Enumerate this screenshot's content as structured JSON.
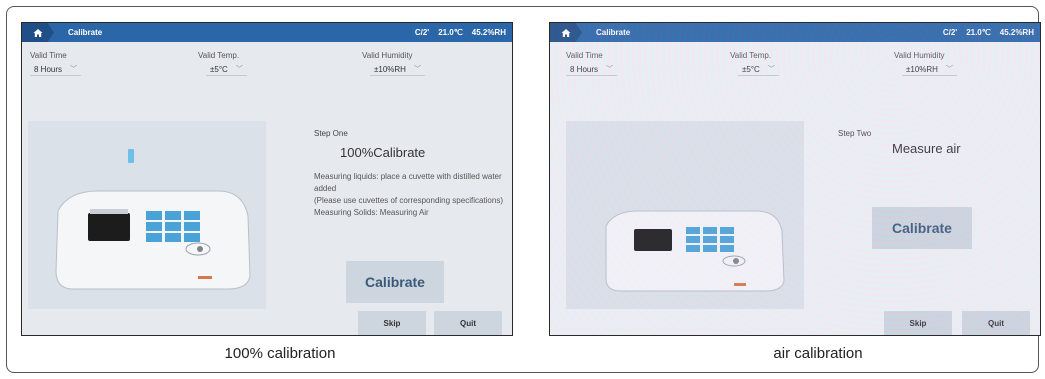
{
  "left": {
    "breadcrumb": "Calibrate",
    "status": {
      "unit": "C/2'",
      "temp": "21.0℃",
      "humidity": "45.2%RH"
    },
    "valid_time": {
      "label": "Valid Time",
      "value": "8 Hours"
    },
    "valid_temp": {
      "label": "Valid Temp.",
      "value": "±5°C"
    },
    "valid_humidity": {
      "label": "Valid Humidity",
      "value": "±10%RH"
    },
    "step": "Step One",
    "heading": "100%Calibrate",
    "description": [
      "Measuring liquids: place a cuvette with distilled water added",
      "(Please use cuvettes of corresponding specifications)",
      "Measuring Solids: Measuring Air"
    ],
    "calibrate_label": "Calibrate",
    "skip_label": "Skip",
    "quit_label": "Quit",
    "caption": "100% calibration"
  },
  "right": {
    "breadcrumb": "Calibrate",
    "status": {
      "unit": "C/2'",
      "temp": "21.0℃",
      "humidity": "45.2%RH"
    },
    "valid_time": {
      "label": "Valid Time",
      "value": "8 Hours"
    },
    "valid_temp": {
      "label": "Valid Temp.",
      "value": "±5°C"
    },
    "valid_humidity": {
      "label": "Valid Humidity",
      "value": "±10%RH"
    },
    "step": "Step Two",
    "heading": "Measure air",
    "calibrate_label": "Calibrate",
    "skip_label": "Skip",
    "quit_label": "Quit",
    "caption": "air calibration"
  },
  "icons": {
    "home": "home-icon",
    "dropdown": "chevron-down-icon"
  },
  "colors": {
    "topbar": "#2b67a8",
    "button": "#cdd6df",
    "screen_bg": "#e6eaef"
  }
}
